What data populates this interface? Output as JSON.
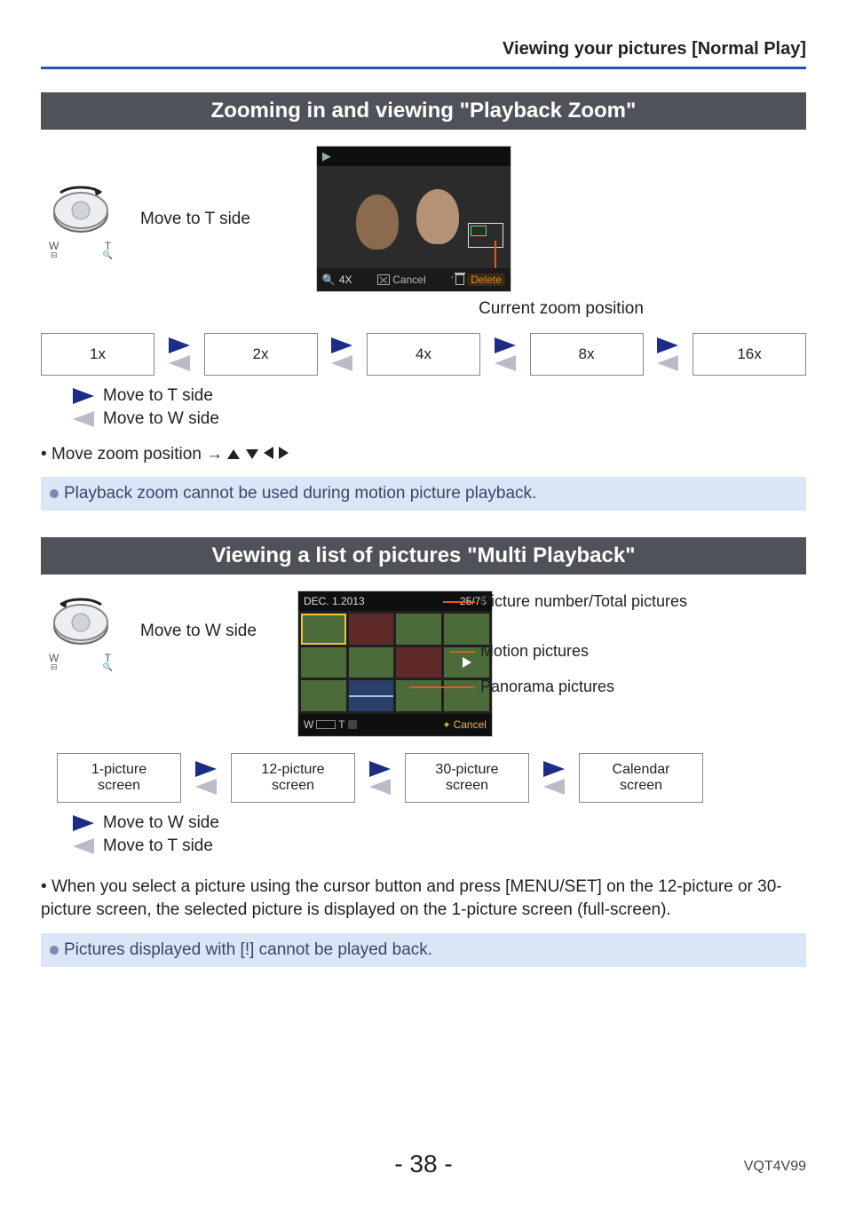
{
  "header": "Viewing your pictures  [Normal Play]",
  "section1": {
    "title": "Zooming in and viewing \"Playback Zoom\"",
    "dial_text": "Move to T side",
    "dial_left": "W",
    "dial_right": "T",
    "preview": {
      "zoom_icon": "🔍",
      "zoom_ratio": "4X",
      "cancel_label": "Cancel",
      "delete_label": "Delete"
    },
    "zoom_position_label": "Current zoom position",
    "zoom_levels": [
      "1x",
      "2x",
      "4x",
      "8x",
      "16x"
    ],
    "legend_t": "Move to T side",
    "legend_w": "Move to W side",
    "move_zoom_prefix": "Move zoom position → ",
    "note": "Playback zoom cannot be used during motion picture playback."
  },
  "section2": {
    "title": "Viewing a list of pictures \"Multi Playback\"",
    "dial_text": "Move to W side",
    "dial_left": "W",
    "dial_right": "T",
    "preview": {
      "date": "DEC. 1.2013",
      "counter": "25/75",
      "cancel_label": "Cancel",
      "bottom_w": "W",
      "bottom_t": "T"
    },
    "callout_picnum": "Picture number/Total pictures",
    "callout_motion": "Motion pictures",
    "callout_pano": "Panorama pictures",
    "screens": [
      {
        "l1": "1-picture",
        "l2": "screen"
      },
      {
        "l1": "12-picture",
        "l2": "screen"
      },
      {
        "l1": "30-picture",
        "l2": "screen"
      },
      {
        "l1": "Calendar",
        "l2": "screen"
      }
    ],
    "legend_w": "Move to W side",
    "legend_t": "Move to T side",
    "body": "When you select a picture using the cursor button and press [MENU/SET] on the 12-picture or 30-picture screen, the selected picture is displayed on the 1-picture screen (full-screen).",
    "note": "Pictures displayed with [!] cannot be played back."
  },
  "footer": {
    "page": "- 38 -",
    "doc_id": "VQT4V99"
  }
}
